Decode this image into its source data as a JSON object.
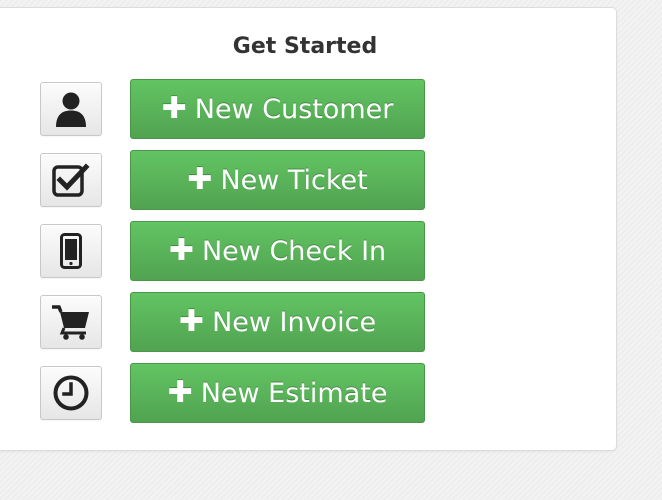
{
  "get_started": {
    "title": "Get Started",
    "plus_symbol": "✚",
    "actions": [
      {
        "label": "New Customer",
        "icon": "user-icon"
      },
      {
        "label": "New Ticket",
        "icon": "checkbox-checked-icon"
      },
      {
        "label": "New Check In",
        "icon": "mobile-phone-icon"
      },
      {
        "label": "New Invoice",
        "icon": "shopping-cart-icon"
      },
      {
        "label": "New Estimate",
        "icon": "clock-icon"
      }
    ]
  },
  "colors": {
    "button_green_top": "#62c462",
    "button_green_bottom": "#51a351",
    "title_text": "#333333",
    "icon_dark": "#222222"
  }
}
